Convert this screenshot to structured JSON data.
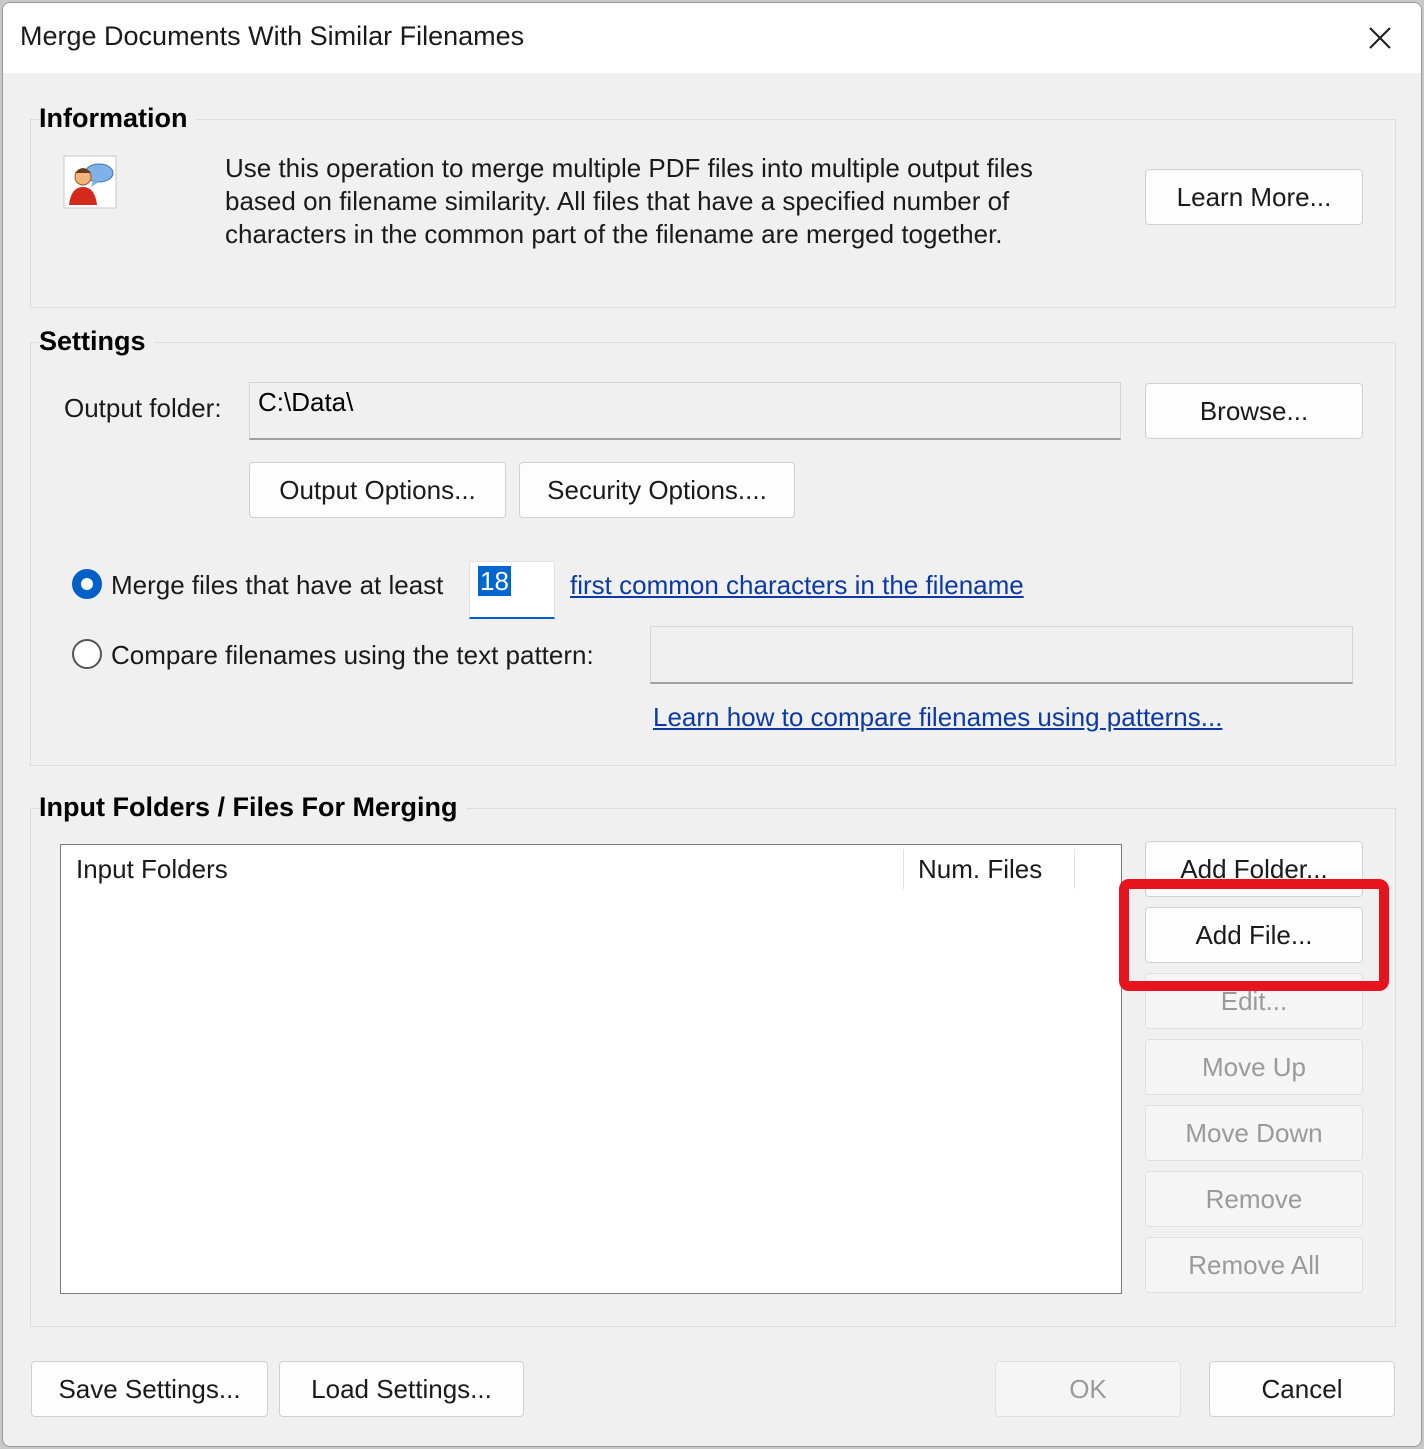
{
  "window": {
    "title": "Merge Documents With Similar Filenames"
  },
  "information": {
    "title": "Information",
    "lines": [
      "Use this operation to merge multiple PDF files into multiple output files",
      "based on filename similarity. All files that have a specified number of",
      "characters in the common part of the filename are merged together."
    ],
    "learn_more": "Learn More..."
  },
  "settings": {
    "title": "Settings",
    "output_folder_label": "Output folder:",
    "output_folder_value": "C:\\Data\\",
    "browse": "Browse...",
    "output_options": "Output Options...",
    "security_options": "Security Options....",
    "merge_radio_label": "Merge files that have at least",
    "merge_count": "18",
    "merge_link": "first common characters in the filename",
    "compare_radio_label": "Compare filenames using the text pattern:",
    "pattern_value": "",
    "pattern_link": "Learn how to compare filenames using patterns..."
  },
  "input": {
    "title": "Input Folders / Files For Merging",
    "columns": [
      "Input Folders",
      "Num. Files"
    ],
    "buttons": {
      "add_folder": "Add Folder...",
      "add_file": "Add File...",
      "edit": "Edit...",
      "move_up": "Move Up",
      "move_down": "Move Down",
      "remove": "Remove",
      "remove_all": "Remove All"
    }
  },
  "footer": {
    "save_settings": "Save Settings...",
    "load_settings": "Load Settings...",
    "ok": "OK",
    "cancel": "Cancel"
  },
  "colors": {
    "highlight": "#e8141d",
    "accent": "#0060c8",
    "link": "#0b3aa6"
  },
  "icons": {
    "close": "close-icon",
    "info": "user-chat-icon"
  }
}
